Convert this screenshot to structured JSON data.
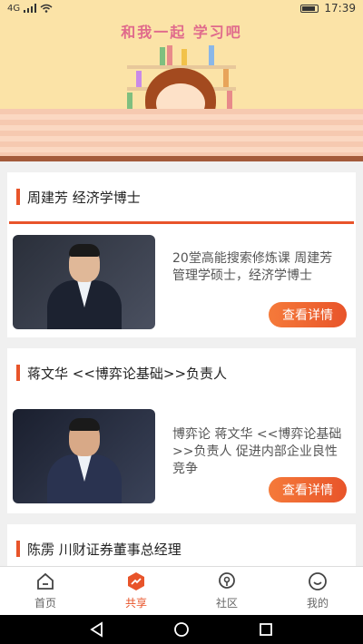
{
  "status": {
    "left": "4G",
    "time": "17:39"
  },
  "banner": {
    "title": "和我一起  学习吧"
  },
  "cards": [
    {
      "title": "周建芳  经济学博士",
      "description": "20堂高能搜索修炼课  周建芳 管理学硕士，经济学博士",
      "button": "查看详情"
    },
    {
      "title": "蒋文华 <<博弈论基础>>负责人",
      "description": "博弈论  蒋文华 <<博弈论基础>>负责人  促进内部企业良性竞争",
      "button": "查看详情"
    },
    {
      "title": "陈雳  川财证券董事总经理"
    }
  ],
  "tabs": [
    {
      "label": "首页",
      "icon": "home-icon"
    },
    {
      "label": "共享",
      "icon": "share-icon",
      "active": true
    },
    {
      "label": "社区",
      "icon": "location-icon"
    },
    {
      "label": "我的",
      "icon": "profile-icon"
    }
  ],
  "colors": {
    "accent": "#e8542a",
    "banner_bg": "#fbe3a7"
  }
}
